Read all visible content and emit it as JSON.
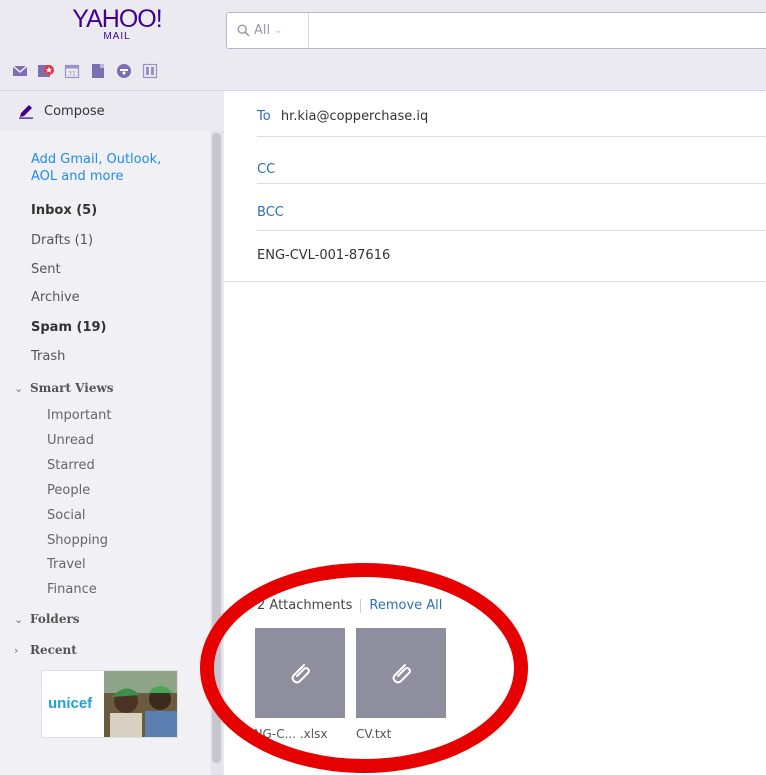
{
  "brand": {
    "logo_text": "YAHOO!",
    "logo_sub": "MAIL",
    "brand_color": "#400090"
  },
  "app_icons": [
    "mail-icon",
    "contacts-icon",
    "calendar-icon",
    "notepad-icon",
    "messenger-icon",
    "newsfeed-icon"
  ],
  "search": {
    "scope_label": "All",
    "value": ""
  },
  "sidebar": {
    "compose_label": "Compose",
    "add_accounts_line1": "Add Gmail, Outlook,",
    "add_accounts_line2": "AOL and more",
    "folders": [
      {
        "label": "Inbox (5)",
        "bold": true
      },
      {
        "label": "Drafts (1)",
        "bold": false
      },
      {
        "label": "Sent",
        "bold": false
      },
      {
        "label": "Archive",
        "bold": false
      },
      {
        "label": "Spam (19)",
        "bold": true
      },
      {
        "label": "Trash",
        "bold": false
      }
    ],
    "smart_views_label": "Smart Views",
    "smart_views": [
      "Important",
      "Unread",
      "Starred",
      "People",
      "Social",
      "Shopping",
      "Travel",
      "Finance"
    ],
    "folders_section_label": "Folders",
    "recent_section_label": "Recent",
    "ad_text": "unicef"
  },
  "compose": {
    "to_label": "To",
    "to_value": "hr.kia@copperchase.iq",
    "cc_label": "CC",
    "bcc_label": "BCC",
    "subject": "ENG-CVL-001-87616",
    "attachments_count_label": "2 Attachments",
    "remove_all_label": "Remove All",
    "attachments": [
      {
        "name": "ENG-C... .xlsx"
      },
      {
        "name": "CV.txt"
      }
    ]
  },
  "colors": {
    "link": "#2a6fb8",
    "annotation": "#e60000",
    "tile": "#8e8f9e"
  }
}
